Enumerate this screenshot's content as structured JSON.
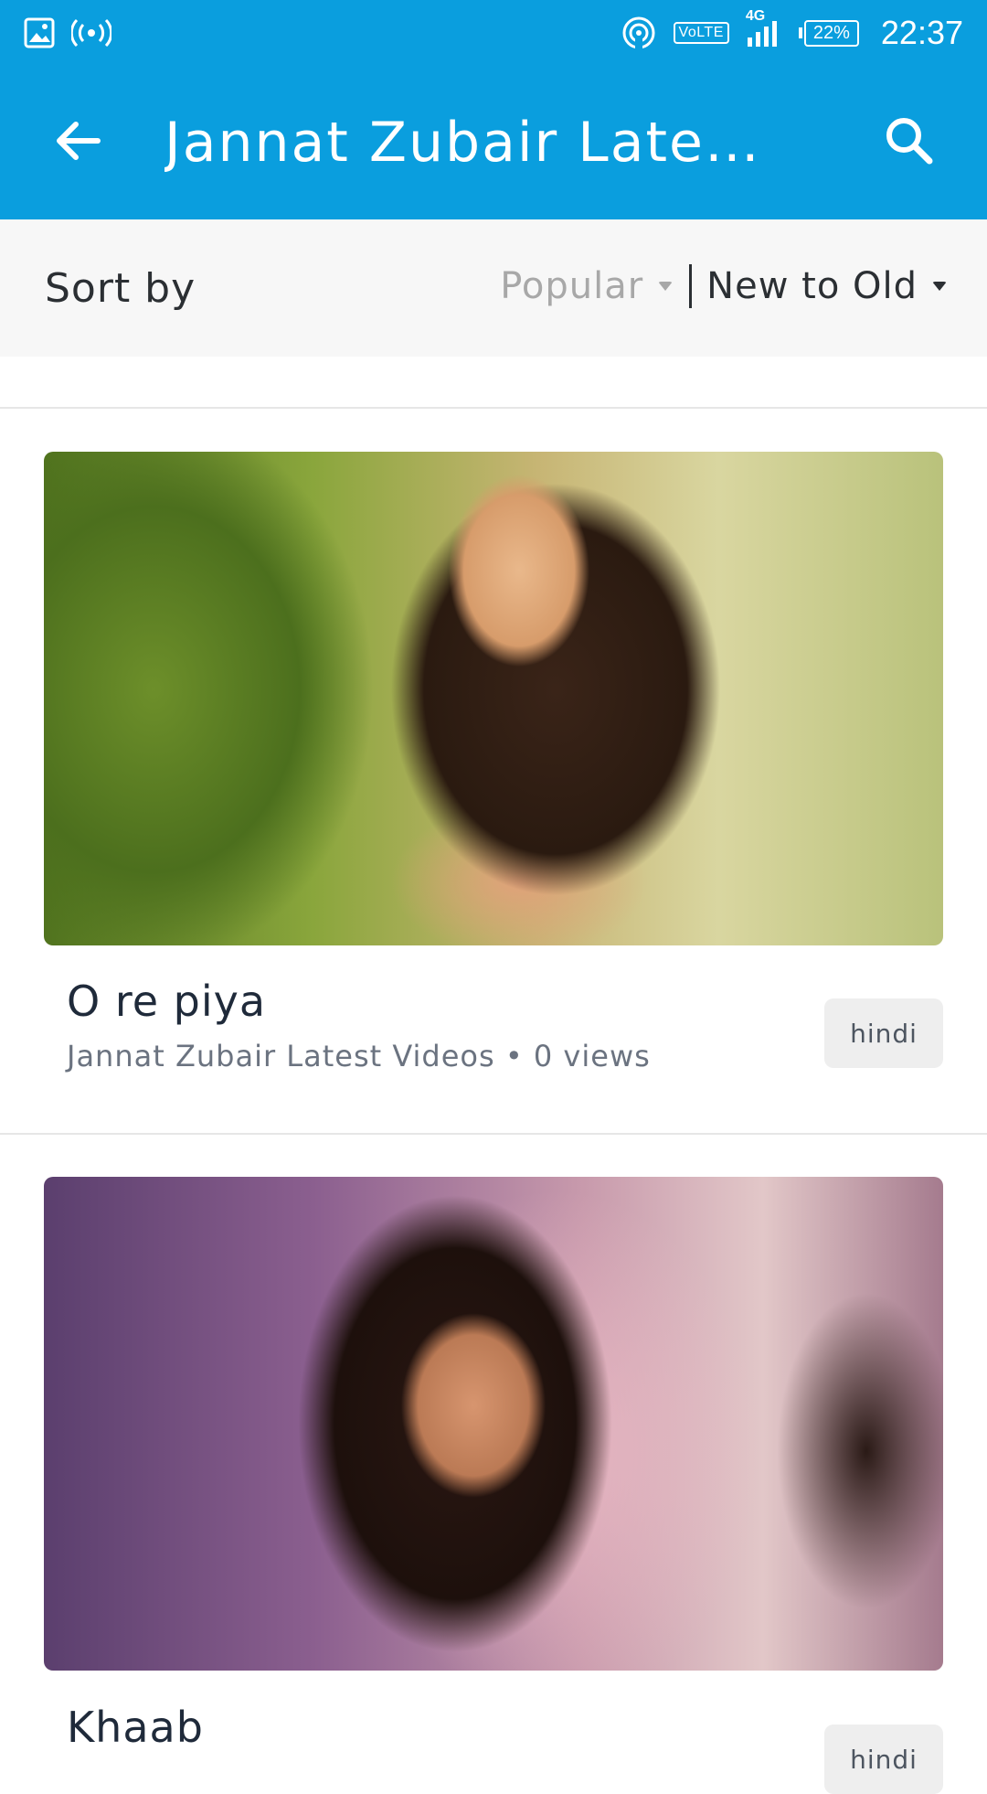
{
  "status_bar": {
    "time": "22:37",
    "network_type": "4G",
    "volte_label": "VoLTE",
    "battery_percent": "22%",
    "icons": [
      "gallery-icon",
      "hotspot-icon",
      "wifi-icon",
      "signal-icon",
      "battery-icon"
    ]
  },
  "app_bar": {
    "title": "Jannat Zubair Latest…",
    "back_icon": "back-arrow-icon",
    "search_icon": "search-icon",
    "background_color": "#0a9ede"
  },
  "sort": {
    "label": "Sort by",
    "options": [
      {
        "label": "Popular",
        "active": false
      },
      {
        "label": "New to Old",
        "active": true
      }
    ]
  },
  "videos": [
    {
      "title": "O re piya",
      "subtitle": "Jannat Zubair Latest Videos • 0 views",
      "language": "hindi"
    },
    {
      "title": "Khaab",
      "subtitle": "",
      "language": "hindi"
    }
  ]
}
